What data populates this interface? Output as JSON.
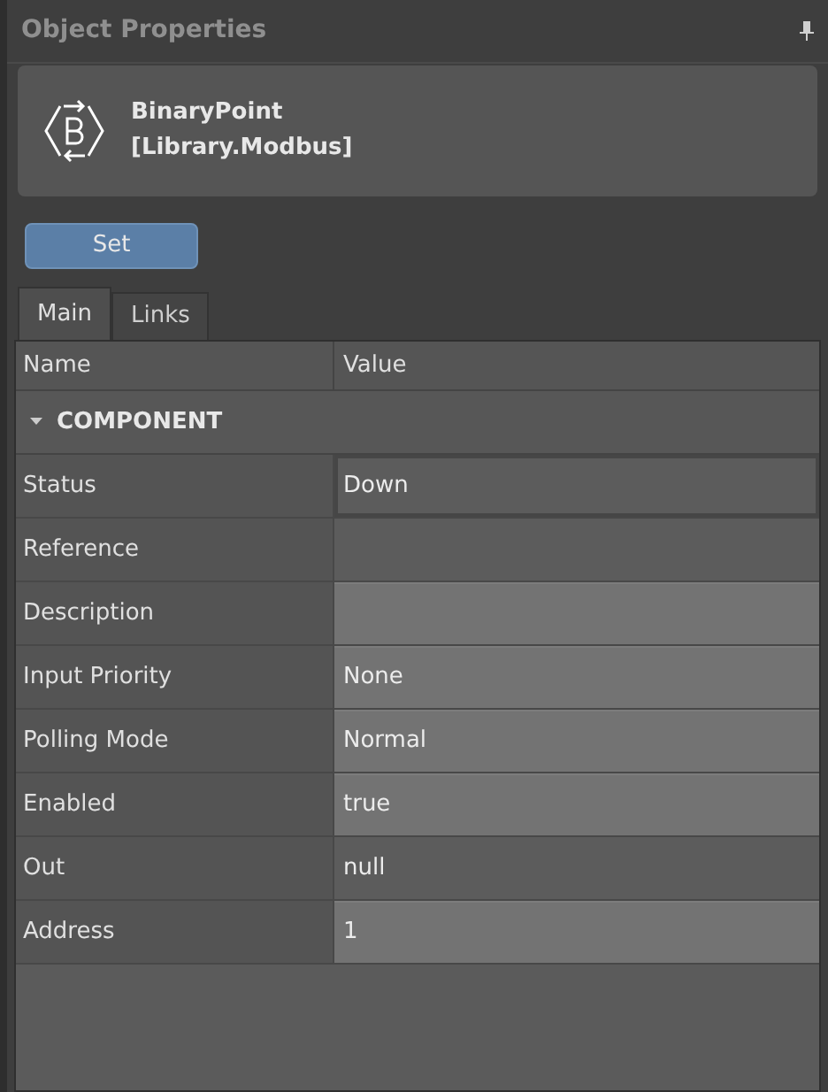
{
  "panel": {
    "title": "Object Properties"
  },
  "object": {
    "name": "BinaryPoint",
    "library": "[Library.Modbus]"
  },
  "set_button": "Set",
  "tabs": [
    {
      "label": "Main",
      "selected": true
    },
    {
      "label": "Links",
      "selected": false
    }
  ],
  "table": {
    "columns": [
      "Name",
      "Value"
    ],
    "category": {
      "label": "COMPONENT",
      "expanded": true
    },
    "rows": [
      {
        "name": "Status",
        "value": "Down",
        "editable": false,
        "selected": true
      },
      {
        "name": "Reference",
        "value": "",
        "editable": false,
        "selected": false
      },
      {
        "name": "Description",
        "value": "",
        "editable": true,
        "selected": false
      },
      {
        "name": "Input Priority",
        "value": "None",
        "editable": true,
        "selected": false
      },
      {
        "name": "Polling Mode",
        "value": "Normal",
        "editable": true,
        "selected": false
      },
      {
        "name": "Enabled",
        "value": "true",
        "editable": true,
        "selected": false
      },
      {
        "name": "Out",
        "value": "null",
        "editable": false,
        "selected": false
      },
      {
        "name": "Address",
        "value": "1",
        "editable": true,
        "selected": false
      }
    ]
  }
}
